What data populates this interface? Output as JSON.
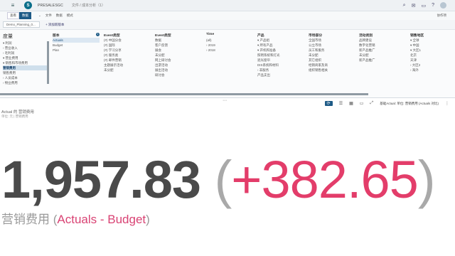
{
  "shell": {
    "brand": "PRESALESGC",
    "breadcrumb": "文件  /  成本分析（1）"
  },
  "toolbar": {
    "tab_view": "查看",
    "tab_edit": "数据",
    "menu_file": "文件",
    "menu_data": "数据",
    "menu_mode": "模式",
    "right": "协作项"
  },
  "storybar": {
    "story_tab": "Demo_Planning_0...",
    "add_label": "+  添加新版本"
  },
  "filters": {
    "measure": {
      "header": "度量",
      "rows": [
        "▾  利润",
        "   ›  营业收入",
        "   ›  毛利润",
        "   ▾  营业费用",
        "      ▾  销售和市场费用",
        "            营销费用",
        "            销售费用",
        "      ›  人员成本",
        "      ›  物业费用"
      ],
      "selected_index": 5
    },
    "version": {
      "header": "版本",
      "rows": [
        "Actuals",
        "Budget",
        "Plan"
      ],
      "selected_index": 0,
      "badge": "1"
    },
    "event_type": {
      "header": "Event类型",
      "rows": [
        "(#) 中国分会",
        "(#) 国际",
        "(#) 学习分享",
        "(#) 服务类",
        "(#) 邮件营销",
        "主题展示活动",
        "未分配"
      ]
    },
    "event": {
      "header": "Event类型",
      "rows": [
        "数据",
        "客户反馈",
        "展会",
        "未分配",
        "网上研讨会",
        "出游活动",
        "展出活动",
        "研讨会"
      ]
    },
    "time": {
      "header": "Time",
      "rows": [
        "(all)",
        "   ›  2019",
        "   ›  2018"
      ]
    },
    "product": {
      "header": "产品",
      "rows": [
        "▾  产品组",
        "   ▾  所有产品",
        "      ▾  开机和准备",
        "            照明系统和灯光",
        "            遮光窗帘",
        "            DIS系统和材料",
        "   ›  非服务",
        "      产品支出"
      ]
    },
    "sales_org": {
      "header": "市场部分",
      "rows": [
        "全国市场",
        "公立市场",
        "员工和服务",
        "未分配",
        "其它组织",
        "经销商家及商",
        "组织销售相关"
      ]
    },
    "sales_channel": {
      "header": "活动类别",
      "rows": [
        "品牌建设",
        "数字化营销",
        "新产品推广",
        "未分配",
        "新产品推广"
      ]
    },
    "region": {
      "header": "销售地区",
      "rows": [
        "▾  全球",
        "   ▾  中国",
        "      ▾  大区1",
        "            北京",
        "            天津",
        "      ›  大区2",
        "   ›  海外"
      ]
    }
  },
  "widget": {
    "header": "Actual 的 营销费用",
    "subheader": "单位: 元 | 营销费用",
    "context": "基础Actual: 单位: 营销费用 (Actuals 对比)",
    "value": "1,957.83",
    "open_paren": "(",
    "delta": "+382.65",
    "close_paren": ")",
    "caption_measure": "营销费用",
    "caption_compare": "Actuals - Budget",
    "colors": {
      "value": "#4a4a4a",
      "delta": "#e33d6a",
      "accent": "#1d5a86"
    }
  }
}
